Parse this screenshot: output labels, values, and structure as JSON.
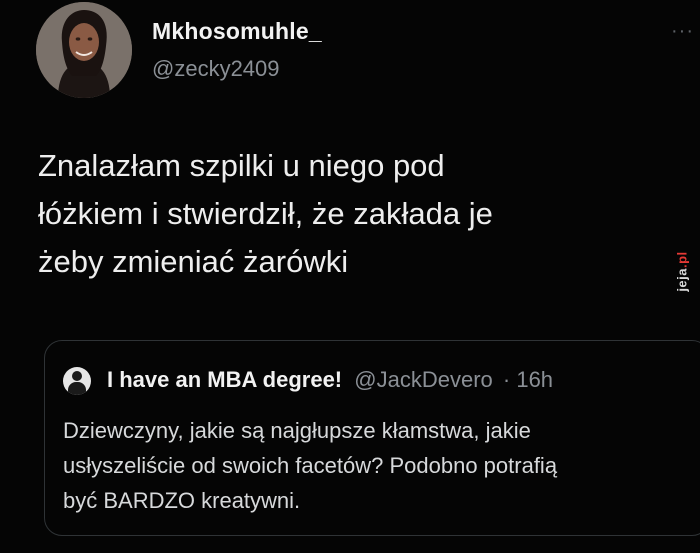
{
  "author": {
    "display_name": "Mkhosomuhle_",
    "handle": "@zecky2409"
  },
  "menu": {
    "more_label": "···"
  },
  "tweet": {
    "lines": [
      "Znalazłam szpilki u niego pod",
      "łóżkiem i stwierdził, że zakłada je",
      "żeby zmieniać żarówki"
    ]
  },
  "quoted_tweet": {
    "display_name": "I have an MBA degree!",
    "handle": "@JackDevero",
    "time": "· 16h",
    "lines": [
      "Dziewczyny, jakie są najgłupsze kłamstwa, jakie",
      "usłyszeliście od swoich facetów? Podobno potrafią",
      "być BARDZO kreatywni."
    ]
  },
  "watermark": {
    "text": "jeja",
    "tld": ".pl"
  },
  "colors": {
    "background": "#050505",
    "text": "#eeeeee",
    "muted": "#8b9096",
    "border": "#2f3336",
    "watermark_accent": "#e53935"
  },
  "icons": [
    "profile-avatar",
    "more-options-icon",
    "quoted-avatar"
  ]
}
